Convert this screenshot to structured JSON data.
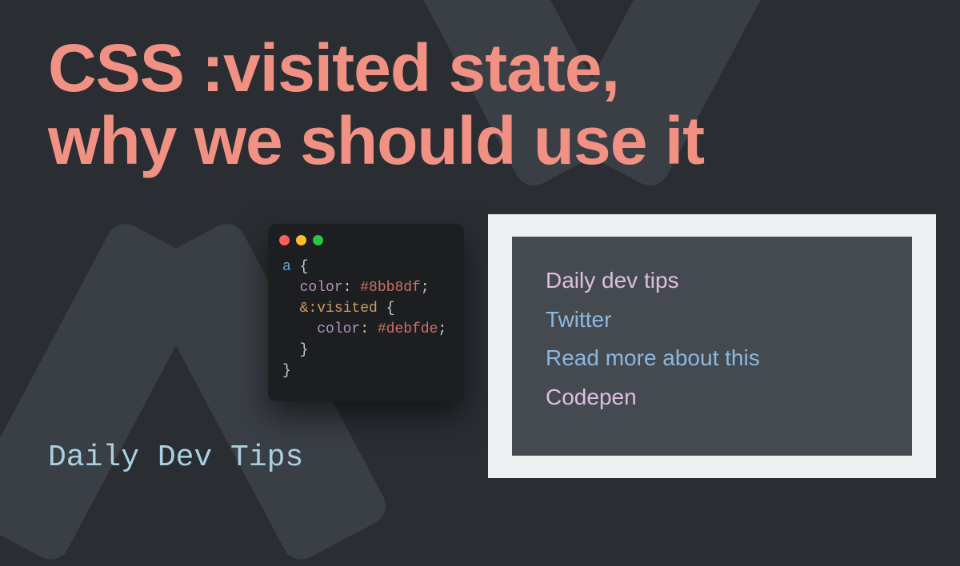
{
  "title_line1": "CSS :visited state,",
  "title_line2": "why we should use it",
  "footer": "Daily Dev Tips",
  "code": {
    "selector": "a",
    "brace_open": " {",
    "prop1": "color",
    "colon": ": ",
    "val1": "#8bb8df",
    "semi": ";",
    "nest_amp": "&",
    "nest_pseudo": ":visited",
    "nest_brace_open": " {",
    "prop2": "color",
    "val2": "#debfde",
    "brace_close": "}"
  },
  "links": [
    {
      "label": "Daily dev tips",
      "state": "visited"
    },
    {
      "label": "Twitter",
      "state": "normal"
    },
    {
      "label": "Read more about this",
      "state": "normal"
    },
    {
      "label": "Codepen",
      "state": "visited"
    }
  ]
}
